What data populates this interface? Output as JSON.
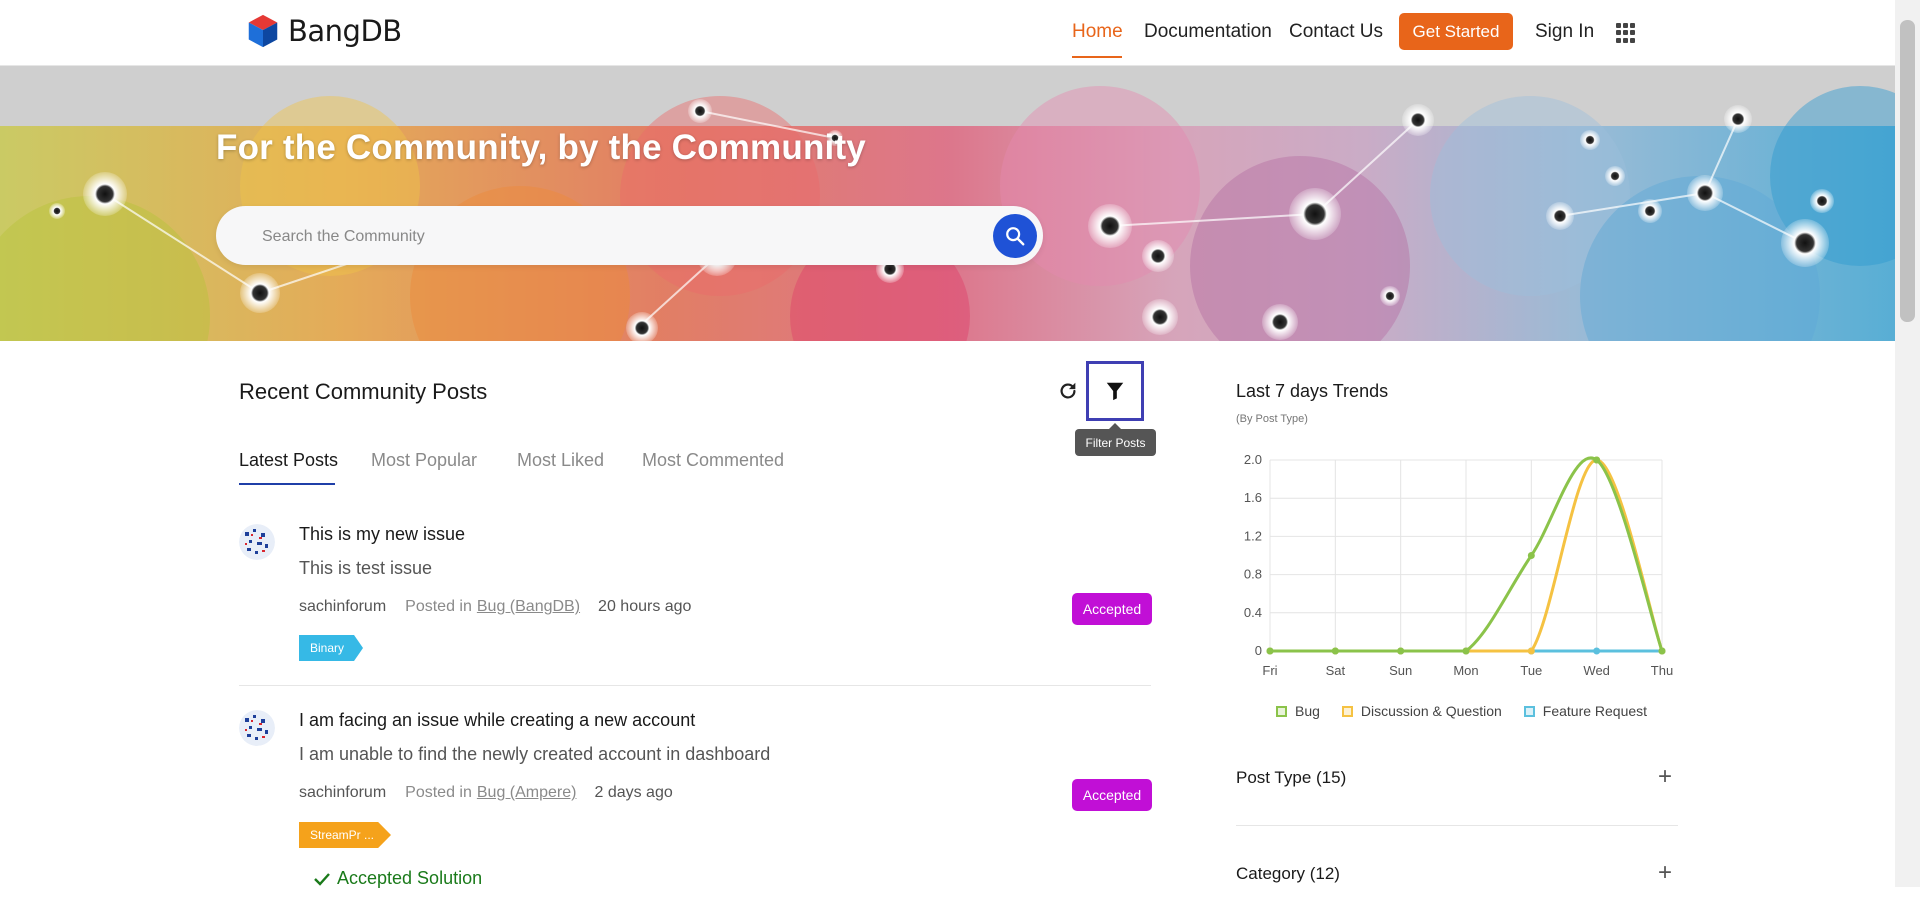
{
  "header": {
    "logo_text": "BangDB",
    "nav": [
      "Home",
      "Documentation",
      "Contact Us"
    ],
    "cta": "Get Started",
    "signin": "Sign In"
  },
  "hero": {
    "title": "For the Community, by the Community",
    "search_placeholder": "Search the Community"
  },
  "posts_section": {
    "title": "Recent Community Posts",
    "filter_tooltip": "Filter Posts",
    "tabs": [
      "Latest Posts",
      "Most Popular",
      "Most Liked",
      "Most Commented"
    ],
    "active_tab": "Latest Posts",
    "posts": [
      {
        "title": "This is my new issue",
        "body": "This is test issue",
        "author": "sachinforum",
        "posted_in": "Posted in",
        "category": "Bug (BangDB)",
        "time": "20 hours ago",
        "status": "Accepted",
        "tag": "Binary",
        "tag_color": "#36b9e6"
      },
      {
        "title": "I am facing an issue while creating a new account",
        "body": "I am unable to find the newly created account in dashboard",
        "author": "sachinforum",
        "posted_in": "Posted in",
        "category": "Bug (Ampere)",
        "time": "2 days ago",
        "status": "Accepted",
        "tag": "StreamPr ...",
        "tag_color": "#f5a21b",
        "accepted_solution": "Accepted Solution"
      }
    ]
  },
  "trends": {
    "title": "Last 7 days Trends",
    "subtitle": "(By Post Type)",
    "accordions": [
      {
        "label": "Post Type (15)"
      },
      {
        "label": "Category (12)"
      }
    ]
  },
  "chart_data": {
    "type": "line",
    "categories": [
      "Fri",
      "Sat",
      "Sun",
      "Mon",
      "Tue",
      "Wed",
      "Thu"
    ],
    "yticks": [
      "2.0",
      "1.6",
      "1.2",
      "0.8",
      "0.4",
      "0"
    ],
    "ylim": [
      0,
      2
    ],
    "grid": true,
    "legend_position": "bottom",
    "series": [
      {
        "name": "Bug",
        "values": [
          0,
          0,
          0,
          0,
          1,
          2,
          0
        ],
        "color": "#8bc34a"
      },
      {
        "name": "Discussion & Question",
        "values": [
          0,
          0,
          0,
          0,
          0,
          2,
          0
        ],
        "color": "#f5c242"
      },
      {
        "name": "Feature Request",
        "values": [
          0,
          0,
          0,
          0,
          0,
          0,
          0
        ],
        "color": "#5bc0de"
      }
    ]
  },
  "colors": {
    "accent": "#e8651a",
    "search_button": "#1f52d6",
    "accepted_badge": "#c10fd6",
    "filter_highlight": "#3f3fb3"
  }
}
